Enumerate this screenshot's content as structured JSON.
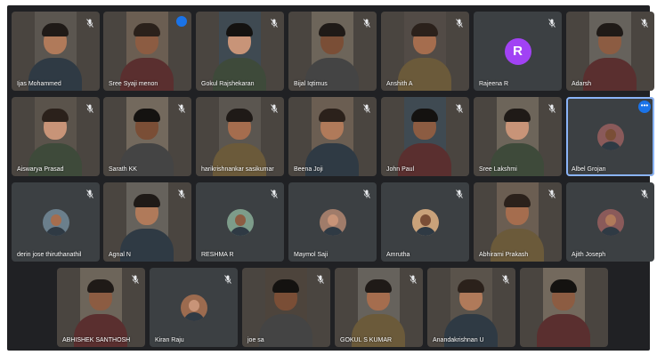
{
  "colors": {
    "stage_bg": "#202124",
    "tile_bg": "#3c4043",
    "active_border": "#8ab4f8",
    "speaking": "#1a73e8"
  },
  "participants": [
    {
      "name": "Ijas Mohammed",
      "type": "video",
      "muted": true
    },
    {
      "name": "Sree Syaji menon",
      "type": "video",
      "speaking": true
    },
    {
      "name": "Gokul Rajshekaran",
      "type": "video",
      "muted": true
    },
    {
      "name": "Bijal Iqtimus",
      "type": "video",
      "muted": true
    },
    {
      "name": "Anshith A",
      "type": "video",
      "muted": true
    },
    {
      "name": "Rajeena R",
      "type": "avatar",
      "initial": "R",
      "avatar_color": "#a142f4",
      "muted": true
    },
    {
      "name": "Adarsh",
      "type": "video",
      "muted": true
    },
    {
      "name": "Aiswarya Prasad",
      "type": "video",
      "muted": true
    },
    {
      "name": "Sarath KK",
      "type": "video",
      "muted": true
    },
    {
      "name": "harikrishnankar sasikumar",
      "type": "video",
      "muted": true
    },
    {
      "name": "Beena Joji",
      "type": "video",
      "muted": true
    },
    {
      "name": "John Paul",
      "type": "video",
      "muted": true
    },
    {
      "name": "Sree Lakshmi",
      "type": "video",
      "muted": true
    },
    {
      "name": "Albel Grojan",
      "type": "photo-avatar",
      "active": true
    },
    {
      "name": "derin jose thiruthanathil",
      "type": "photo-avatar",
      "muted": true
    },
    {
      "name": "Agnal N",
      "type": "video",
      "muted": true
    },
    {
      "name": "RESHMA R",
      "type": "photo-avatar",
      "muted": true
    },
    {
      "name": "Maymol Saji",
      "type": "photo-avatar",
      "muted": true
    },
    {
      "name": "Amrutha",
      "type": "photo-avatar",
      "muted": true
    },
    {
      "name": "Abhirami Prakash",
      "type": "video",
      "muted": true
    },
    {
      "name": "Ajith Joseph",
      "type": "photo-avatar",
      "muted": true
    },
    {
      "name": "ABHISHEK SANTHOSH",
      "type": "video",
      "muted": true
    },
    {
      "name": "Kiran Raju",
      "type": "photo-avatar",
      "muted": true
    },
    {
      "name": "joe sa",
      "type": "video",
      "muted": true
    },
    {
      "name": "GOKUL S KUMAR",
      "type": "video",
      "muted": true
    },
    {
      "name": "Anandakrishnan U",
      "type": "video",
      "muted": true
    },
    {
      "name": "",
      "type": "video",
      "muted": false
    }
  ]
}
